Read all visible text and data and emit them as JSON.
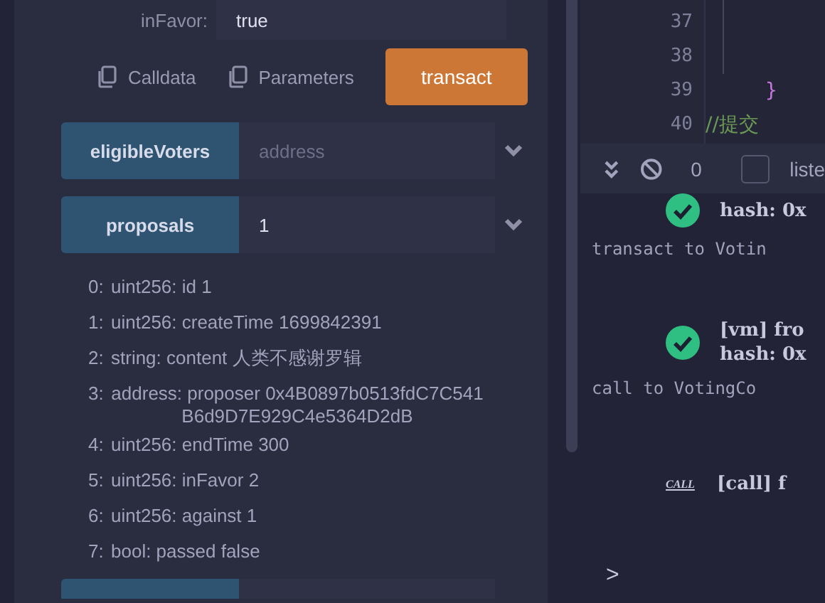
{
  "input_field": {
    "label": "inFavor:",
    "value": "true"
  },
  "actions": [
    {
      "kind": "copy",
      "label": "Calldata"
    },
    {
      "kind": "copy",
      "label": "Parameters"
    },
    {
      "kind": "primary",
      "label": "transact"
    }
  ],
  "functions": [
    {
      "name": "eligibleVoters",
      "placeholder": "address"
    },
    {
      "name": "proposals",
      "value": "1"
    }
  ],
  "outputs": [
    {
      "index": "0:",
      "text": "uint256: id 1"
    },
    {
      "index": "1:",
      "text": "uint256: createTime 1699842391"
    },
    {
      "index": "2:",
      "text": "string: content 人类不感谢罗辑"
    },
    {
      "index": "3:",
      "text": "address: proposer 0x4B0897b0513fdC7C541B6d9D7E929C4e5364D2dB"
    },
    {
      "index": "4:",
      "text": "uint256: endTime 300"
    },
    {
      "index": "5:",
      "text": "uint256: inFavor 2"
    },
    {
      "index": "6:",
      "text": "uint256: against 1"
    },
    {
      "index": "7:",
      "text": "bool: passed false"
    }
  ],
  "editor": {
    "lines": [
      {
        "number": "37",
        "kind": "blank"
      },
      {
        "number": "38",
        "kind": "blank"
      },
      {
        "number": "39",
        "kind": "brace",
        "code": "}"
      },
      {
        "number": "40",
        "kind": "comment",
        "code": "//提交"
      }
    ]
  },
  "terminal_toolbar": {
    "count": "0",
    "listen_checked": false,
    "listen_label": "liste"
  },
  "terminal_entries": [
    {
      "kind": "success",
      "lines": [
        "hash: 0x"
      ],
      "summary": "transact to Votin"
    },
    {
      "kind": "success",
      "lines": [
        "[vm] fro",
        "hash: 0x"
      ],
      "summary": "call to VotingCo"
    },
    {
      "kind": "call",
      "badge": "CALL",
      "lines": [
        "[call] f"
      ]
    }
  ],
  "prompt": ">"
}
